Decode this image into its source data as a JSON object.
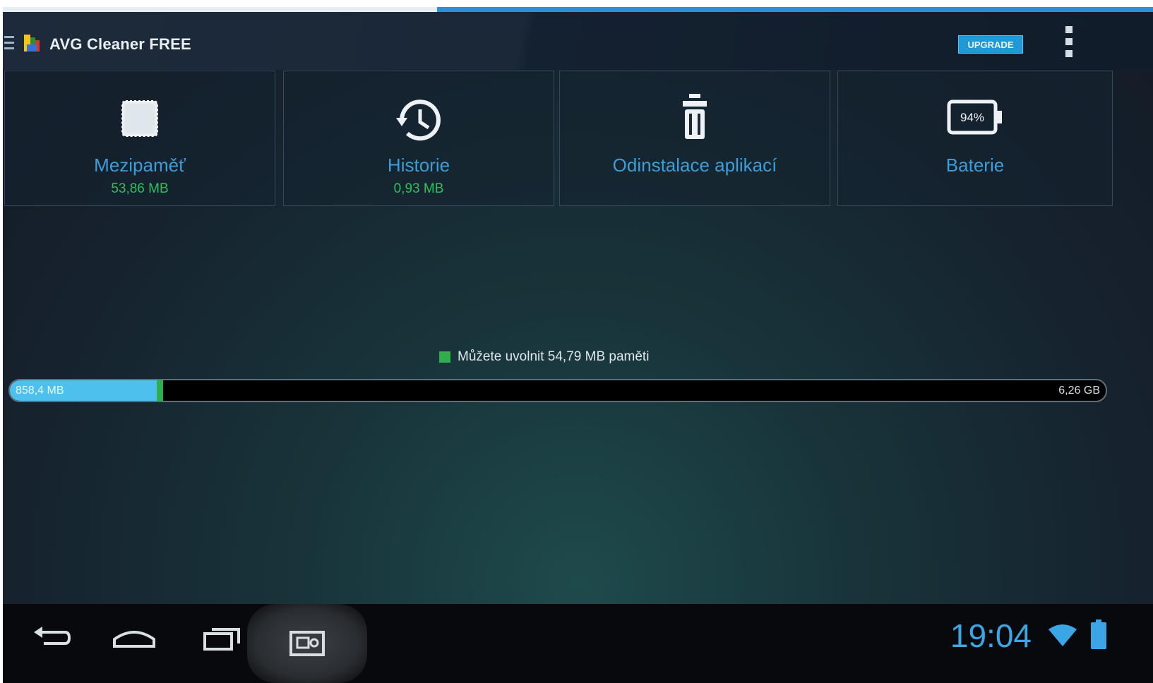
{
  "app": {
    "title": "AVG Cleaner FREE",
    "upgrade_label": "UPGRADE"
  },
  "tiles": [
    {
      "label": "Mezipaměť",
      "value": "53,86 MB",
      "icon": "chip-icon"
    },
    {
      "label": "Historie",
      "value": "0,93 MB",
      "icon": "history-icon"
    },
    {
      "label": "Odinstalace aplikací",
      "value": "",
      "icon": "trash-icon"
    },
    {
      "label": "Baterie",
      "value": "",
      "icon": "battery-icon",
      "battery_percent": "94%"
    }
  ],
  "memory": {
    "free_message": "Můžete uvolnit 54,79 MB paměti",
    "used_label": "858,4 MB",
    "total_label": "6,26 GB",
    "used_fraction": 0.134,
    "freeable_fraction": 0.006
  },
  "system": {
    "time": "19:04"
  },
  "colors": {
    "accent": "#3e9cd6",
    "value_green": "#2fbf5c",
    "bar_used": "#4ec0ee",
    "upgrade_bg": "#1f9ad6"
  }
}
